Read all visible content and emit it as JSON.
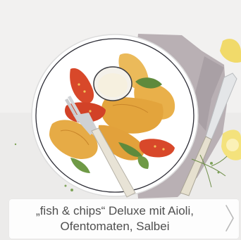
{
  "recipe": {
    "title_line1": "„fish & chips“ Deluxe mit Aioli,",
    "title_line2": "Ofentomaten, Salbei"
  },
  "next_icon": "chevron-right-icon",
  "colors": {
    "caption_text": "#4f4f4f",
    "chevron": "#b9b9b9",
    "plate": "#ffffff",
    "napkin": "#b9b0b4",
    "fries": "#e9b04a",
    "tomato": "#d8482a",
    "sage": "#5f8a3c"
  }
}
